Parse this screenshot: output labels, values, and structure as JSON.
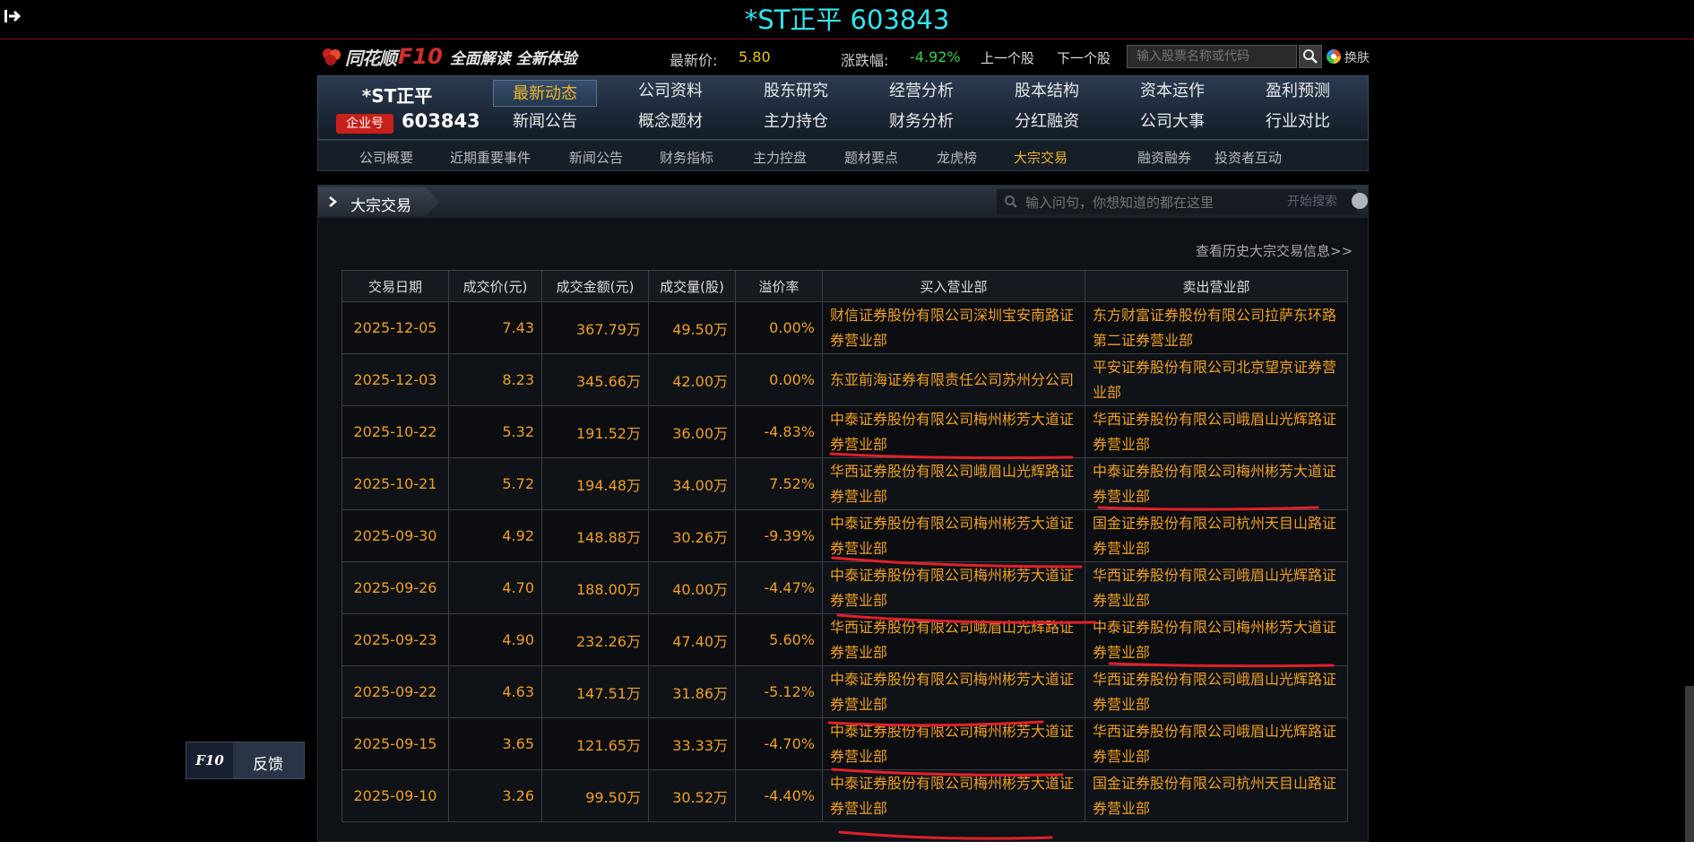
{
  "window": {
    "title": "*ST正平 603843"
  },
  "header": {
    "logo_brand": "同花顺",
    "logo_f10": "F10",
    "logo_slogan": "全面解读 全新体验",
    "price_label": "最新价:",
    "price_value": "5.80",
    "change_label": "涨跌幅:",
    "change_value": "-4.92%",
    "prev_stock": "上一个股",
    "next_stock": "下一个股",
    "search_placeholder": "输入股票名称或代码",
    "skin_label": "换肤"
  },
  "stock": {
    "name": "*ST正平",
    "badge": "企业号",
    "code": "603843"
  },
  "nav": {
    "row1": [
      "最新动态",
      "公司资料",
      "股东研究",
      "经营分析",
      "股本结构",
      "资本运作",
      "盈利预测"
    ],
    "row2": [
      "新闻公告",
      "概念题材",
      "主力持仓",
      "财务分析",
      "分红融资",
      "公司大事",
      "行业对比"
    ],
    "active": "最新动态"
  },
  "subnav": {
    "items": [
      "公司概要",
      "近期重要事件",
      "新闻公告",
      "财务指标",
      "主力控盘",
      "题材要点",
      "龙虎榜",
      "大宗交易",
      "融资融券",
      "投资者互动"
    ],
    "active": "大宗交易"
  },
  "section": {
    "title": "大宗交易",
    "ask_placeholder": "输入问句，你想知道的都在这里",
    "ask_button": "开始搜索",
    "history_link": "查看历史大宗交易信息>>"
  },
  "table": {
    "headers": [
      "交易日期",
      "成交价(元)",
      "成交金额(元)",
      "成交量(股)",
      "溢价率",
      "买入营业部",
      "卖出营业部"
    ],
    "rows": [
      [
        "2025-12-05",
        "7.43",
        "367.79万",
        "49.50万",
        "0.00%",
        "财信证券股份有限公司深圳宝安南路证券营业部",
        "东方财富证券股份有限公司拉萨东环路第二证券营业部"
      ],
      [
        "2025-12-03",
        "8.23",
        "345.66万",
        "42.00万",
        "0.00%",
        "东亚前海证券有限责任公司苏州分公司",
        "平安证券股份有限公司北京望京证券营业部"
      ],
      [
        "2025-10-22",
        "5.32",
        "191.52万",
        "36.00万",
        "-4.83%",
        "中泰证券股份有限公司梅州彬芳大道证券营业部",
        "华西证券股份有限公司峨眉山光辉路证券营业部"
      ],
      [
        "2025-10-21",
        "5.72",
        "194.48万",
        "34.00万",
        "7.52%",
        "华西证券股份有限公司峨眉山光辉路证券营业部",
        "中泰证券股份有限公司梅州彬芳大道证券营业部"
      ],
      [
        "2025-09-30",
        "4.92",
        "148.88万",
        "30.26万",
        "-9.39%",
        "中泰证券股份有限公司梅州彬芳大道证券营业部",
        "国金证券股份有限公司杭州天目山路证券营业部"
      ],
      [
        "2025-09-26",
        "4.70",
        "188.00万",
        "40.00万",
        "-4.47%",
        "中泰证券股份有限公司梅州彬芳大道证券营业部",
        "华西证券股份有限公司峨眉山光辉路证券营业部"
      ],
      [
        "2025-09-23",
        "4.90",
        "232.26万",
        "47.40万",
        "5.60%",
        "华西证券股份有限公司峨眉山光辉路证券营业部",
        "中泰证券股份有限公司梅州彬芳大道证券营业部"
      ],
      [
        "2025-09-22",
        "4.63",
        "147.51万",
        "31.86万",
        "-5.12%",
        "中泰证券股份有限公司梅州彬芳大道证券营业部",
        "华西证券股份有限公司峨眉山光辉路证券营业部"
      ],
      [
        "2025-09-15",
        "3.65",
        "121.65万",
        "33.33万",
        "-4.70%",
        "中泰证券股份有限公司梅州彬芳大道证券营业部",
        "华西证券股份有限公司峨眉山光辉路证券营业部"
      ],
      [
        "2025-09-10",
        "3.26",
        "99.50万",
        "30.52万",
        "-4.40%",
        "中泰证券股份有限公司梅州彬芳大道证券营业部",
        "国金证券股份有限公司杭州天目山路证券营业部"
      ]
    ]
  },
  "feedback": {
    "f10": "F10",
    "label": "反馈"
  },
  "colors": {
    "accent_orange": "#f0a020",
    "title_cyan": "#2ee6f0",
    "badge_red": "#c8201a",
    "mark_red": "#e0202a"
  }
}
